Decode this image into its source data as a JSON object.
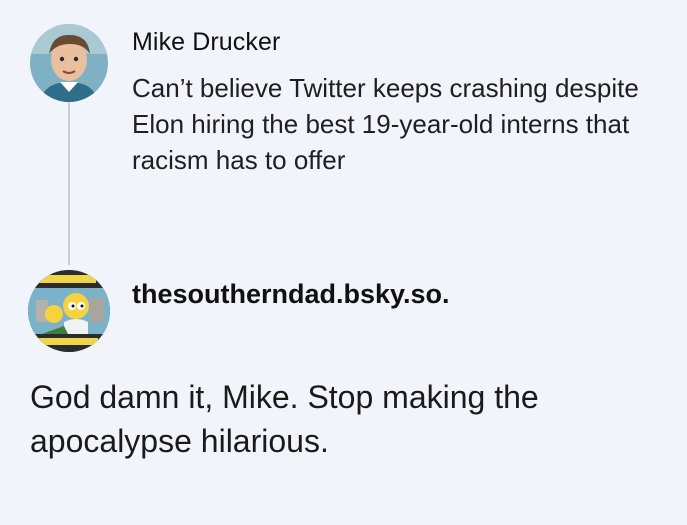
{
  "post": {
    "author_name": "Mike Drucker",
    "avatar_icon": "profile-photo-icon",
    "text": "Can’t believe Twitter keeps crashing despite Elon hiring the best 19-year-old interns that racism has to offer"
  },
  "reply": {
    "handle": "thesoutherndad.bsky.so.",
    "avatar_icon": "cartoon-profile-icon",
    "text": "God damn it, Mike. Stop making the apocalypse hilarious."
  },
  "colors": {
    "background": "#f1f5fb",
    "thread_line": "#c9cdd4",
    "text": "#1a1a1a"
  }
}
